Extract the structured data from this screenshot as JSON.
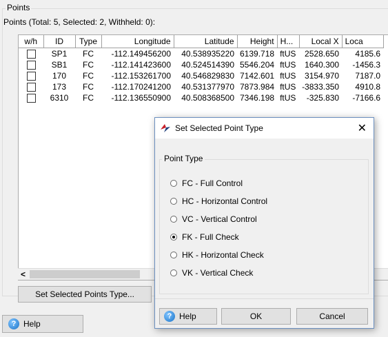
{
  "points_group": {
    "legend": "Points",
    "summary": "Points (Total: 5, Selected: 2, Withheld: 0):"
  },
  "table": {
    "columns": [
      "w/h",
      "ID",
      "Type",
      "Longitude",
      "Latitude",
      "Height",
      "H...",
      "Local X",
      "Loca"
    ],
    "rows": [
      {
        "id": "SP1",
        "type": "FC",
        "longitude": "-112.149456200",
        "latitude": "40.538935220",
        "height": "6139.718",
        "h_unit": "ftUS",
        "local_x": "2528.650",
        "local_y": "4185.6"
      },
      {
        "id": "SB1",
        "type": "FC",
        "longitude": "-112.141423600",
        "latitude": "40.524514390",
        "height": "5546.204",
        "h_unit": "ftUS",
        "local_x": "1640.300",
        "local_y": "-1456.3"
      },
      {
        "id": "170",
        "type": "FC",
        "longitude": "-112.153261700",
        "latitude": "40.546829830",
        "height": "7142.601",
        "h_unit": "ftUS",
        "local_x": "3154.970",
        "local_y": "7187.0"
      },
      {
        "id": "173",
        "type": "FC",
        "longitude": "-112.170241200",
        "latitude": "40.531377970",
        "height": "7873.984",
        "h_unit": "ftUS",
        "local_x": "-3833.350",
        "local_y": "4910.8"
      },
      {
        "id": "6310",
        "type": "FC",
        "longitude": "-112.136550900",
        "latitude": "40.508368500",
        "height": "7346.198",
        "h_unit": "ftUS",
        "local_x": "-325.830",
        "local_y": "-7166.6"
      }
    ]
  },
  "scroll": {
    "left_arrow": "<"
  },
  "buttons": {
    "set_type": "Set Selected Points Type...",
    "help": "Help"
  },
  "dialog": {
    "title": "Set Selected Point Type",
    "close": "✕",
    "group_label": "Point Type",
    "options": [
      {
        "label": "FC - Full Control",
        "selected": false
      },
      {
        "label": "HC - Horizontal Control",
        "selected": false
      },
      {
        "label": "VC - Vertical Control",
        "selected": false
      },
      {
        "label": "FK - Full Check",
        "selected": true
      },
      {
        "label": "HK - Horizontal Check",
        "selected": false
      },
      {
        "label": "VK - Vertical Check",
        "selected": false
      }
    ],
    "help": "Help",
    "ok": "OK",
    "cancel": "Cancel"
  },
  "icons": {
    "help": "help-icon",
    "app": "app-icon"
  }
}
